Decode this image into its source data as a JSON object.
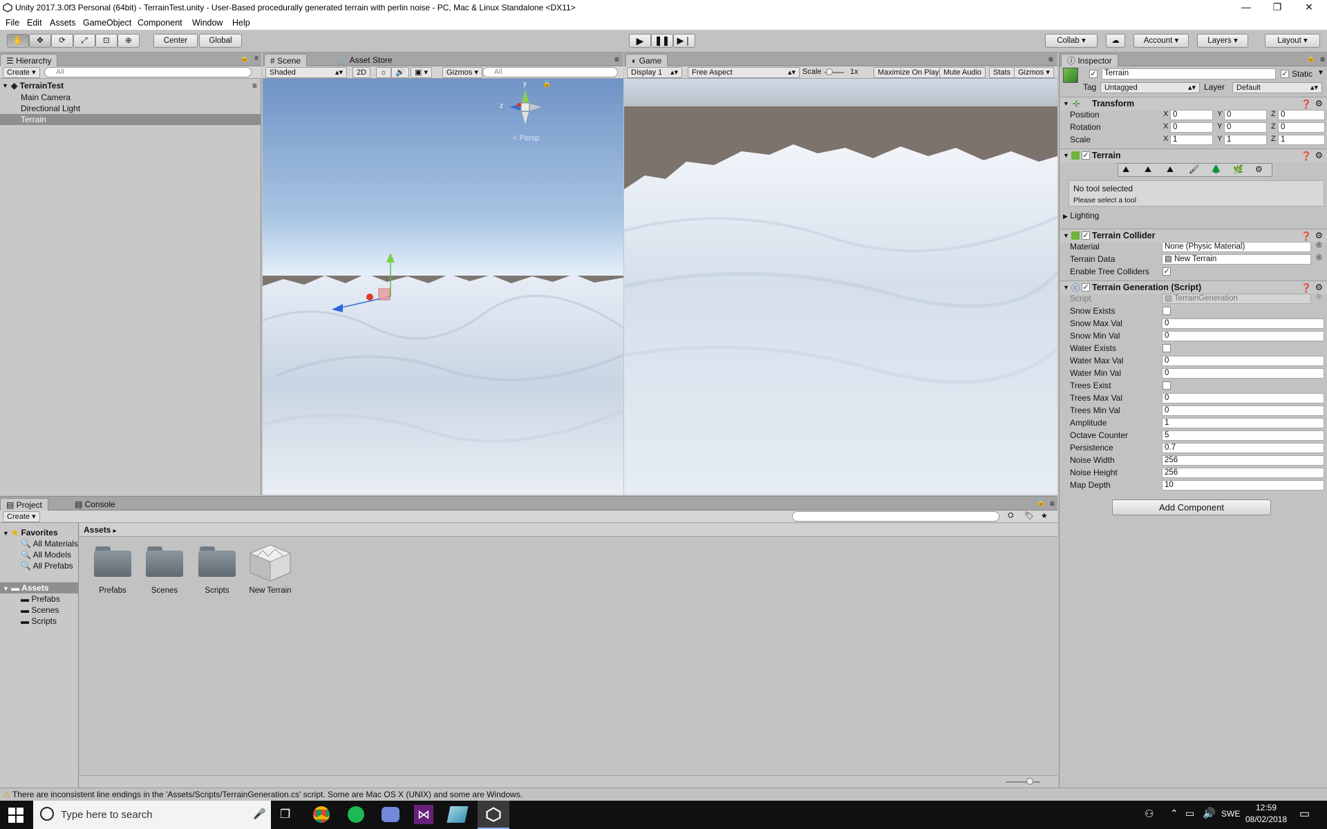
{
  "window": {
    "title": "Unity 2017.3.0f3 Personal (64bit) - TerrainTest.unity - User-Based procedurally generated terrain with perlin noise - PC, Mac & Linux Standalone <DX11>",
    "controls": {
      "minimize": "—",
      "restore": "❐",
      "close": "✕"
    }
  },
  "menu": [
    "File",
    "Edit",
    "Assets",
    "GameObject",
    "Component",
    "Window",
    "Help"
  ],
  "toolbar": {
    "pivot": "Center",
    "space": "Global",
    "collab": "Collab",
    "account": "Account",
    "layers": "Layers",
    "layout": "Layout"
  },
  "hierarchy": {
    "tab": "Hierarchy",
    "create": "Create",
    "search_placeholder": "All",
    "scene": "TerrainTest",
    "items": [
      "Main Camera",
      "Directional Light",
      "Terrain"
    ],
    "selected": "Terrain"
  },
  "scene_view": {
    "tabs": [
      "Scene",
      "Asset Store"
    ],
    "shading": "Shaded",
    "mode_2d": "2D",
    "gizmos": "Gizmos",
    "search_placeholder": "All",
    "persp": "Persp",
    "axis_y": "y",
    "axis_z": "z"
  },
  "game_view": {
    "tab": "Game",
    "display": "Display 1",
    "aspect": "Free Aspect",
    "scale_label": "Scale",
    "scale_value": "1x",
    "options": [
      "Maximize On Play",
      "Mute Audio",
      "Stats",
      "Gizmos"
    ]
  },
  "inspector": {
    "tab": "Inspector",
    "object_name": "Terrain",
    "static_label": "Static",
    "tag_label": "Tag",
    "tag_value": "Untagged",
    "layer_label": "Layer",
    "layer_value": "Default",
    "transform": {
      "title": "Transform",
      "rows": [
        {
          "label": "Position",
          "x": "0",
          "y": "0",
          "z": "0"
        },
        {
          "label": "Rotation",
          "x": "0",
          "y": "0",
          "z": "0"
        },
        {
          "label": "Scale",
          "x": "1",
          "y": "1",
          "z": "1"
        }
      ]
    },
    "terrain": {
      "title": "Terrain",
      "help_line1": "No tool selected",
      "help_line2": "Please select a tool",
      "lighting": "Lighting"
    },
    "collider": {
      "title": "Terrain Collider",
      "material_label": "Material",
      "material_value": "None (Physic Material)",
      "data_label": "Terrain Data",
      "data_value": "New Terrain",
      "trees_label": "Enable Tree Colliders"
    },
    "script": {
      "title": "Terrain Generation (Script)",
      "script_label": "Script",
      "script_value": "TerrainGeneration",
      "fields": [
        {
          "label": "Snow Exists",
          "type": "bool",
          "value": ""
        },
        {
          "label": "Snow Max Val",
          "type": "num",
          "value": "0"
        },
        {
          "label": "Snow Min Val",
          "type": "num",
          "value": "0"
        },
        {
          "label": "Water Exists",
          "type": "bool",
          "value": ""
        },
        {
          "label": "Water Max Val",
          "type": "num",
          "value": "0"
        },
        {
          "label": "Water Min Val",
          "type": "num",
          "value": "0"
        },
        {
          "label": "Trees Exist",
          "type": "bool",
          "value": ""
        },
        {
          "label": "Trees Max Val",
          "type": "num",
          "value": "0"
        },
        {
          "label": "Trees Min Val",
          "type": "num",
          "value": "0"
        },
        {
          "label": "Amplitude",
          "type": "num",
          "value": "1"
        },
        {
          "label": "Octave Counter",
          "type": "num",
          "value": "5"
        },
        {
          "label": "Persistence",
          "type": "num",
          "value": "0.7"
        },
        {
          "label": "Noise Width",
          "type": "num",
          "value": "256"
        },
        {
          "label": "Noise Height",
          "type": "num",
          "value": "256"
        },
        {
          "label": "Map Depth",
          "type": "num",
          "value": "10"
        }
      ]
    },
    "add_component": "Add Component"
  },
  "project": {
    "tabs": [
      "Project",
      "Console"
    ],
    "create": "Create",
    "favorites": "Favorites",
    "favorite_items": [
      "All Materials",
      "All Models",
      "All Prefabs"
    ],
    "assets_root": "Assets",
    "asset_folders": [
      "Prefabs",
      "Scenes",
      "Scripts"
    ],
    "breadcrumb": "Assets",
    "grid_items": [
      "Prefabs",
      "Scenes",
      "Scripts",
      "New Terrain"
    ]
  },
  "status": {
    "message": "There are inconsistent line endings in the 'Assets/Scripts/TerrainGeneration.cs' script. Some are Mac OS X (UNIX) and some are Windows."
  },
  "taskbar": {
    "search_placeholder": "Type here to search",
    "language": "SWE",
    "time": "12:59",
    "date": "08/02/2018"
  }
}
